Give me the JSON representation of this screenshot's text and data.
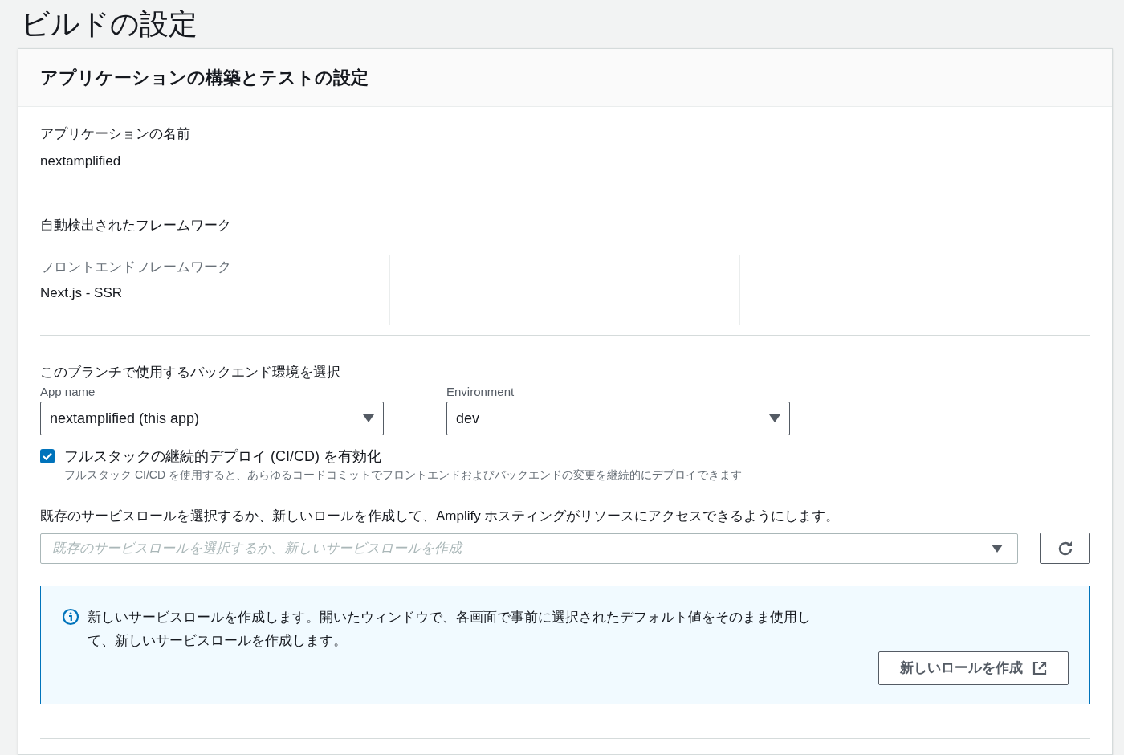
{
  "page_title": "ビルドの設定",
  "card": {
    "title": "アプリケーションの構築とテストの設定",
    "app_name": {
      "label": "アプリケーションの名前",
      "value": "nextamplified"
    },
    "framework": {
      "heading": "自動検出されたフレームワーク",
      "label": "フロントエンドフレームワーク",
      "value": "Next.js - SSR"
    },
    "backend": {
      "heading": "このブランチで使用するバックエンド環境を選択",
      "selects": [
        {
          "label": "App name",
          "value": "nextamplified (this app)"
        },
        {
          "label": "Environment",
          "value": "dev"
        }
      ]
    },
    "cicd": {
      "checked": true,
      "label": "フルスタックの継続的デプロイ (CI/CD) を有効化",
      "description": "フルスタック CI/CD を使用すると、あらゆるコードコミットでフロントエンドおよびバックエンドの変更を継続的にデプロイできます"
    },
    "service_role": {
      "label": "既存のサービスロールを選択するか、新しいロールを作成して、Amplify ホスティングがリソースにアクセスできるようにします。",
      "placeholder": "既存のサービスロールを選択するか、新しいサービスロールを作成"
    },
    "info": {
      "text": "新しいサービスロールを作成します。開いたウィンドウで、各画面で事前に選択されたデフォルト値をそのまま使用して、新しいサービスロールを作成します。",
      "button": "新しいロールを作成"
    }
  }
}
